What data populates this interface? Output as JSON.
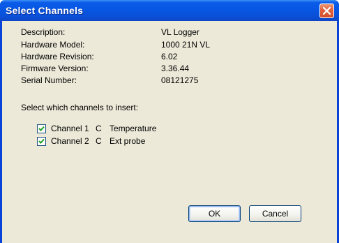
{
  "window": {
    "title": "Select Channels",
    "close_label": "Close"
  },
  "info": [
    {
      "key": "Description:",
      "value": "VL Logger"
    },
    {
      "key": "Hardware Model:",
      "value": "1000 21N VL"
    },
    {
      "key": "Hardware Revision:",
      "value": "6.02"
    },
    {
      "key": "Firmware Version:",
      "value": "3.36.44"
    },
    {
      "key": "Serial Number:",
      "value": "08121275"
    }
  ],
  "prompt": "Select which channels to insert:",
  "channels": [
    {
      "label": "Channel 1",
      "unit": "C",
      "name": "Temperature",
      "checked": true
    },
    {
      "label": "Channel 2",
      "unit": "C",
      "name": "Ext probe",
      "checked": true
    }
  ],
  "buttons": {
    "ok": "OK",
    "cancel": "Cancel"
  },
  "colors": {
    "titlebar": "#0757e4",
    "dialog_face": "#ece9d8",
    "close_button": "#e2633e"
  },
  "icons": {
    "close": "close-icon",
    "check": "checkmark-icon"
  }
}
